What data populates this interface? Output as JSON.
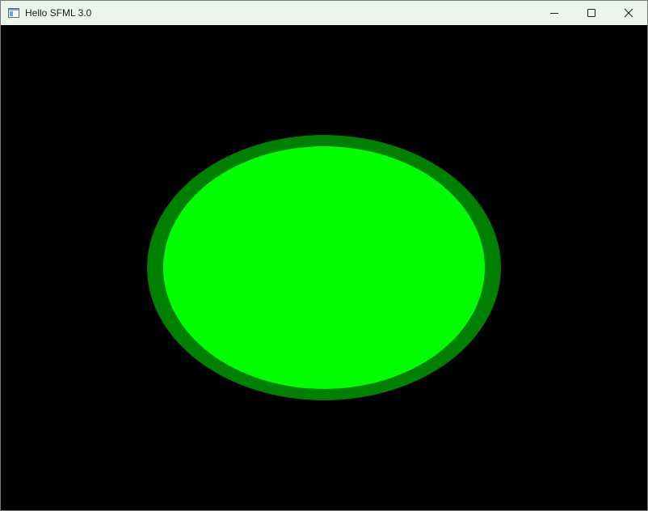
{
  "window": {
    "title": "Hello SFML 3.0",
    "icon": "sfml-app-icon",
    "controls": [
      {
        "name": "minimize-button",
        "icon": "minimize-icon"
      },
      {
        "name": "maximize-button",
        "icon": "maximize-icon"
      },
      {
        "name": "close-button",
        "icon": "close-icon"
      }
    ]
  },
  "canvas": {
    "background_color": "#000000",
    "shape": {
      "type": "circle",
      "fill_color": "#00ff00",
      "outline_color": "#008000"
    }
  }
}
